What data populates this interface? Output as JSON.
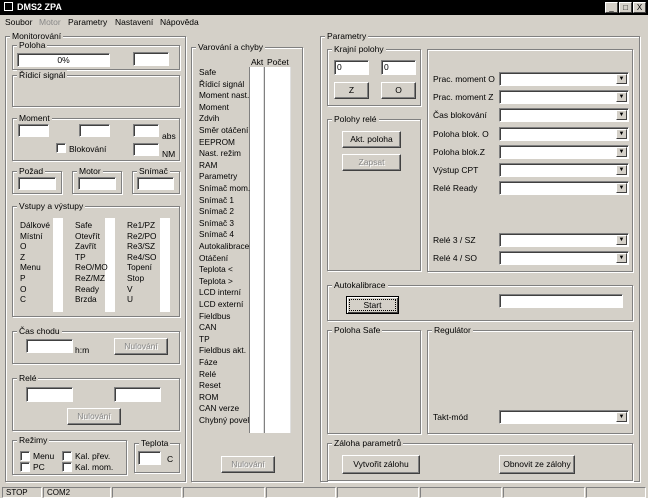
{
  "window": {
    "title": "DMS2 ZPA"
  },
  "window_buttons": [
    "_",
    "□",
    "X"
  ],
  "menu": [
    {
      "label": "Soubor",
      "enabled": true
    },
    {
      "label": "Motor",
      "enabled": false
    },
    {
      "label": "Parametry",
      "enabled": true
    },
    {
      "label": "Nastavení",
      "enabled": true
    },
    {
      "label": "Nápověda",
      "enabled": true
    }
  ],
  "monitoring": {
    "title": "Monitorování",
    "poloha": {
      "title": "Poloha",
      "value": "0%",
      "value2": ""
    },
    "ridici_signal": {
      "title": "Řídicí signál"
    },
    "moment": {
      "title": "Moment",
      "abs_label": "abs",
      "nm_label": "NM",
      "blokovani_label": "Blokování"
    },
    "pozad": {
      "title": "Požad"
    },
    "motor": {
      "title": "Motor"
    },
    "snimac": {
      "title": "Snímač"
    },
    "io": {
      "title": "Vstupy a výstupy",
      "col1": [
        "Dálkové",
        "Místní",
        "O",
        "Z",
        "Menu",
        "P",
        "O",
        "C"
      ],
      "col2": [
        "Safe",
        "Otevřít",
        "Zavřít",
        "TP",
        "ReO/MO",
        "ReZ/MZ",
        "Ready",
        "Brzda"
      ],
      "col3": [
        "Re1/PZ",
        "Re2/PO",
        "Re3/SZ",
        "Re4/SO",
        "Topení",
        "Stop",
        "V",
        "U"
      ]
    },
    "cas_chodu": {
      "title": "Čas chodu",
      "unit": "h:m",
      "reset_label": "Nulování"
    },
    "rele": {
      "title": "Relé",
      "reset_label": "Nulování"
    },
    "rezimy": {
      "title": "Režimy",
      "options": [
        "Menu",
        "Kal. přev.",
        "PC",
        "Kal. mom."
      ]
    },
    "teplota": {
      "title": "Teplota",
      "unit": "C"
    }
  },
  "errors": {
    "title": "Varování a chyby",
    "col_akt": "Akt",
    "col_pocet": "Počet",
    "rows": [
      "Safe",
      "Řídicí signál",
      "Moment nast.",
      "Moment",
      "Zdvih",
      "Směr otáčení",
      "EEPROM",
      "Nast. režim",
      "RAM",
      "Parametry",
      "Snímač mom.",
      "Snímač 1",
      "Snímač 2",
      "Snímač 3",
      "Snímač 4",
      "Autokalibrace",
      "Otáčení",
      "Teplota <",
      "Teplota >",
      "LCD interní",
      "LCD externí",
      "Fieldbus",
      "CAN",
      "TP",
      "Fieldbus akt.",
      "Fáze",
      "Relé",
      "Reset",
      "ROM",
      "CAN verze",
      "Chybný povel"
    ],
    "reset_label": "Nulování"
  },
  "parameters": {
    "title": "Parametry",
    "krajni_polohy": {
      "title": "Krajní polohy",
      "value_left": "0",
      "value_right": "0",
      "btn_z": "Z",
      "btn_o": "O"
    },
    "polohy_rele": {
      "title": "Polohy relé",
      "akt_label": "Akt. poloha",
      "zapsat_label": "Zapsat"
    },
    "combos": [
      "Prac. moment O",
      "Prac. moment Z",
      "Čas blokování",
      "Poloha blok. O",
      "Poloha blok.Z",
      "Výstup CPT",
      "Relé Ready"
    ],
    "combos2": [
      "Relé 3 / SZ",
      "Relé 4 / SO"
    ],
    "autokalibrace": {
      "title": "Autokalibrace",
      "start_label": "Start"
    },
    "poloha_safe": {
      "title": "Poloha Safe"
    },
    "regulator": {
      "title": "Regulátor",
      "takt_label": "Takt-mód"
    },
    "zaloha": {
      "title": "Záloha parametrů",
      "create_label": "Vytvořit zálohu",
      "restore_label": "Obnovit ze zálohy"
    }
  },
  "status": {
    "cells": [
      "STOP",
      "COM2"
    ]
  }
}
